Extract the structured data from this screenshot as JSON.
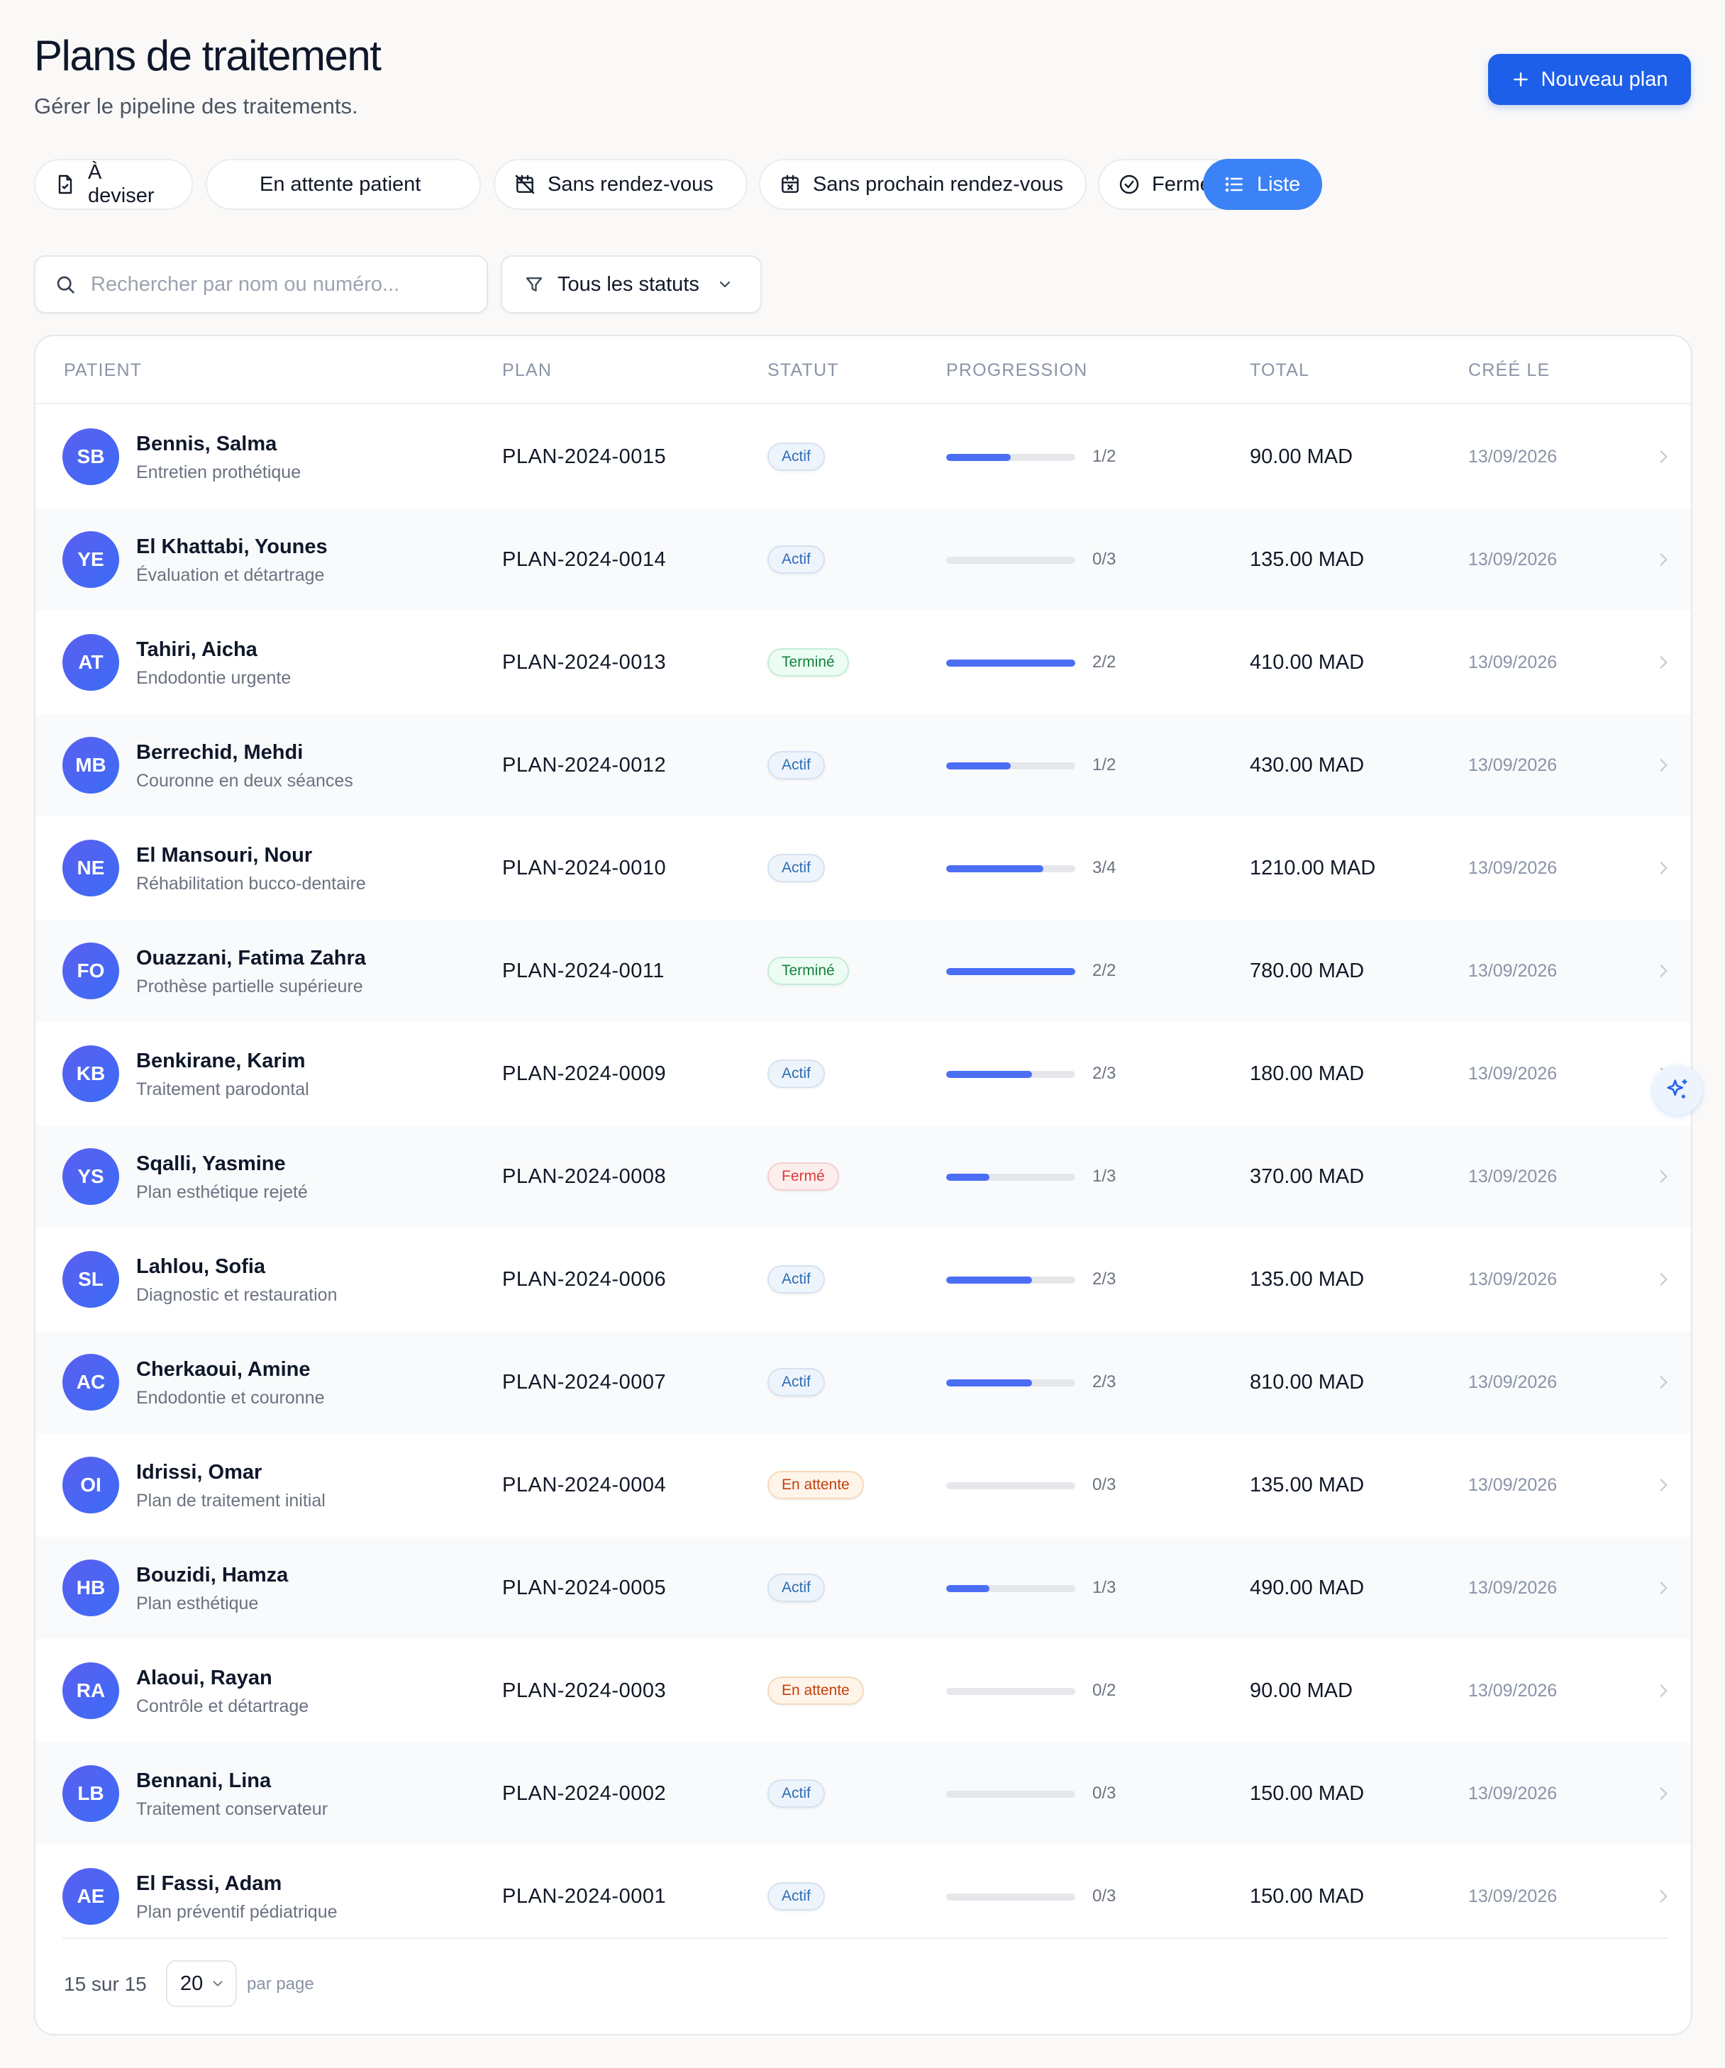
{
  "header": {
    "title": "Plans de traitement",
    "subtitle": "Gérer le pipeline des traitements.",
    "new_button_label": "Nouveau plan"
  },
  "filters": [
    {
      "label": "À deviser",
      "icon": "file-icon"
    },
    {
      "label": "En attente patient",
      "icon": ""
    },
    {
      "label": "Sans rendez-vous",
      "icon": "calendar-off-icon"
    },
    {
      "label": "Sans prochain rendez-vous",
      "icon": "calendar-x-icon"
    },
    {
      "label": "Fermés",
      "icon": "check-circle-icon"
    },
    {
      "label": "Liste",
      "icon": "list-icon",
      "active": true
    }
  ],
  "search": {
    "placeholder": "Rechercher par nom ou numéro...",
    "value": ""
  },
  "status_filter": {
    "label": "Tous les statuts"
  },
  "table": {
    "columns": [
      "PATIENT",
      "PLAN",
      "STATUT",
      "PROGRESSION",
      "TOTAL",
      "CRÉÉ LE"
    ],
    "rows": [
      {
        "initials": "SB",
        "name": "Bennis, Salma",
        "desc": "Entretien prothétique",
        "plan": "PLAN-2024-0015",
        "status": "Actif",
        "status_type": "actif",
        "progress": "1/2",
        "progress_ratio": 0.5,
        "total": "90.00 MAD",
        "created": "13/09/2026"
      },
      {
        "initials": "YE",
        "name": "El Khattabi, Younes",
        "desc": "Évaluation et détartrage",
        "plan": "PLAN-2024-0014",
        "status": "Actif",
        "status_type": "actif",
        "progress": "0/3",
        "progress_ratio": 0,
        "total": "135.00 MAD",
        "created": "13/09/2026"
      },
      {
        "initials": "AT",
        "name": "Tahiri, Aicha",
        "desc": "Endodontie urgente",
        "plan": "PLAN-2024-0013",
        "status": "Terminé",
        "status_type": "termine",
        "progress": "2/2",
        "progress_ratio": 1,
        "total": "410.00 MAD",
        "created": "13/09/2026"
      },
      {
        "initials": "MB",
        "name": "Berrechid, Mehdi",
        "desc": "Couronne en deux séances",
        "plan": "PLAN-2024-0012",
        "status": "Actif",
        "status_type": "actif",
        "progress": "1/2",
        "progress_ratio": 0.5,
        "total": "430.00 MAD",
        "created": "13/09/2026"
      },
      {
        "initials": "NE",
        "name": "El Mansouri, Nour",
        "desc": "Réhabilitation bucco-dentaire",
        "plan": "PLAN-2024-0010",
        "status": "Actif",
        "status_type": "actif",
        "progress": "3/4",
        "progress_ratio": 0.75,
        "total": "1210.00 MAD",
        "created": "13/09/2026"
      },
      {
        "initials": "FO",
        "name": "Ouazzani, Fatima Zahra",
        "desc": "Prothèse partielle supérieure",
        "plan": "PLAN-2024-0011",
        "status": "Terminé",
        "status_type": "termine",
        "progress": "2/2",
        "progress_ratio": 1,
        "total": "780.00 MAD",
        "created": "13/09/2026"
      },
      {
        "initials": "KB",
        "name": "Benkirane, Karim",
        "desc": "Traitement parodontal",
        "plan": "PLAN-2024-0009",
        "status": "Actif",
        "status_type": "actif",
        "progress": "2/3",
        "progress_ratio": 0.667,
        "total": "180.00 MAD",
        "created": "13/09/2026"
      },
      {
        "initials": "YS",
        "name": "Sqalli, Yasmine",
        "desc": "Plan esthétique rejeté",
        "plan": "PLAN-2024-0008",
        "status": "Fermé",
        "status_type": "ferme",
        "progress": "1/3",
        "progress_ratio": 0.333,
        "total": "370.00 MAD",
        "created": "13/09/2026"
      },
      {
        "initials": "SL",
        "name": "Lahlou, Sofia",
        "desc": "Diagnostic et restauration",
        "plan": "PLAN-2024-0006",
        "status": "Actif",
        "status_type": "actif",
        "progress": "2/3",
        "progress_ratio": 0.667,
        "total": "135.00 MAD",
        "created": "13/09/2026"
      },
      {
        "initials": "AC",
        "name": "Cherkaoui, Amine",
        "desc": "Endodontie et couronne",
        "plan": "PLAN-2024-0007",
        "status": "Actif",
        "status_type": "actif",
        "progress": "2/3",
        "progress_ratio": 0.667,
        "total": "810.00 MAD",
        "created": "13/09/2026"
      },
      {
        "initials": "OI",
        "name": "Idrissi, Omar",
        "desc": "Plan de traitement initial",
        "plan": "PLAN-2024-0004",
        "status": "En attente",
        "status_type": "attente",
        "progress": "0/3",
        "progress_ratio": 0,
        "total": "135.00 MAD",
        "created": "13/09/2026"
      },
      {
        "initials": "HB",
        "name": "Bouzidi, Hamza",
        "desc": "Plan esthétique",
        "plan": "PLAN-2024-0005",
        "status": "Actif",
        "status_type": "actif",
        "progress": "1/3",
        "progress_ratio": 0.333,
        "total": "490.00 MAD",
        "created": "13/09/2026"
      },
      {
        "initials": "RA",
        "name": "Alaoui, Rayan",
        "desc": "Contrôle et détartrage",
        "plan": "PLAN-2024-0003",
        "status": "En attente",
        "status_type": "attente",
        "progress": "0/2",
        "progress_ratio": 0,
        "total": "90.00 MAD",
        "created": "13/09/2026"
      },
      {
        "initials": "LB",
        "name": "Bennani, Lina",
        "desc": "Traitement conservateur",
        "plan": "PLAN-2024-0002",
        "status": "Actif",
        "status_type": "actif",
        "progress": "0/3",
        "progress_ratio": 0,
        "total": "150.00 MAD",
        "created": "13/09/2026"
      },
      {
        "initials": "AE",
        "name": "El Fassi, Adam",
        "desc": "Plan préventif pédiatrique",
        "plan": "PLAN-2024-0001",
        "status": "Actif",
        "status_type": "actif",
        "progress": "0/3",
        "progress_ratio": 0,
        "total": "150.00 MAD",
        "created": "13/09/2026"
      }
    ]
  },
  "pagination": {
    "count_text": "15 sur 15",
    "per_page_value": "20",
    "per_page_label": "par page"
  },
  "colors": {
    "primary": "#1d5fe8",
    "active_chip": "#3b82f6",
    "progress_fill": "#4c6ef5"
  }
}
